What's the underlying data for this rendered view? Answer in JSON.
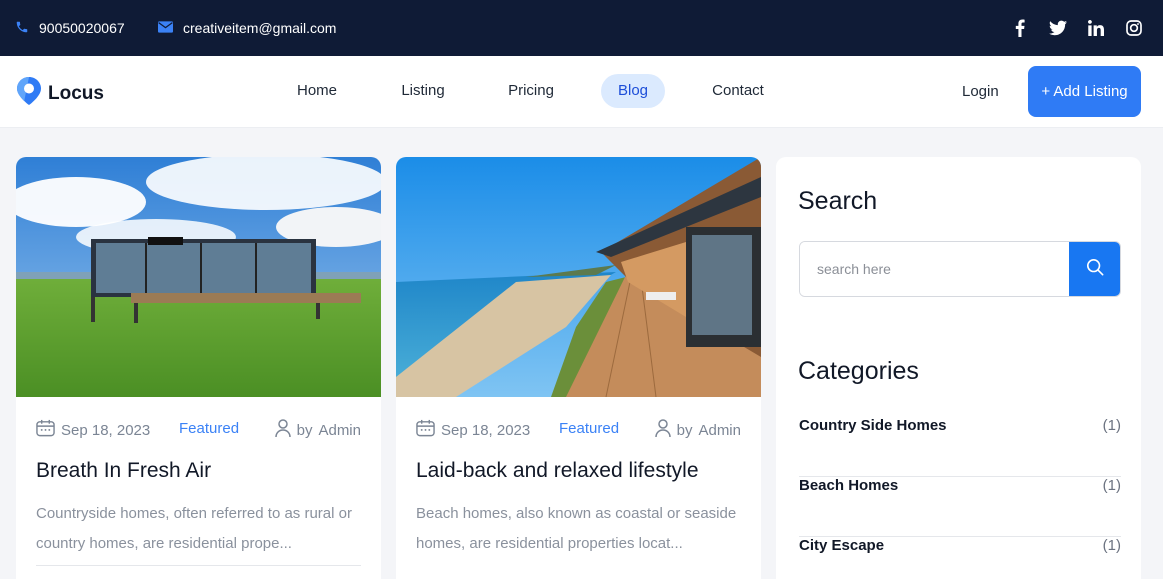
{
  "topbar": {
    "phone": "90050020067",
    "email": "creativeitem@gmail.com",
    "social": [
      "facebook-icon",
      "twitter-icon",
      "linkedin-icon",
      "instagram-icon"
    ]
  },
  "nav": {
    "brand": "Locus",
    "items": [
      "Home",
      "Listing",
      "Pricing",
      "Blog",
      "Contact"
    ],
    "active": "Blog",
    "login": "Login",
    "add_listing": "+ Add Listing"
  },
  "posts": [
    {
      "date": "Sep 18, 2023",
      "category": "Featured",
      "by": "by",
      "author": "Admin",
      "title": "Breath In Fresh Air",
      "excerpt": "Countryside homes, often referred to as rural or country homes, are residential prope..."
    },
    {
      "date": "Sep 18, 2023",
      "category": "Featured",
      "by": "by",
      "author": "Admin",
      "title": "Laid-back and relaxed lifestyle",
      "excerpt": "Beach homes, also known as coastal or seaside homes, are residential properties locat..."
    }
  ],
  "sidebar": {
    "search_title": "Search",
    "search_placeholder": "search here",
    "categories_title": "Categories",
    "categories": [
      {
        "name": "Country Side Homes",
        "count": "(1)"
      },
      {
        "name": "Beach Homes",
        "count": "(1)"
      },
      {
        "name": "City Escape",
        "count": "(1)"
      }
    ]
  },
  "colors": {
    "topbar": "#0f1b36",
    "accent": "#2f7bf5",
    "link": "#3b82f6"
  }
}
